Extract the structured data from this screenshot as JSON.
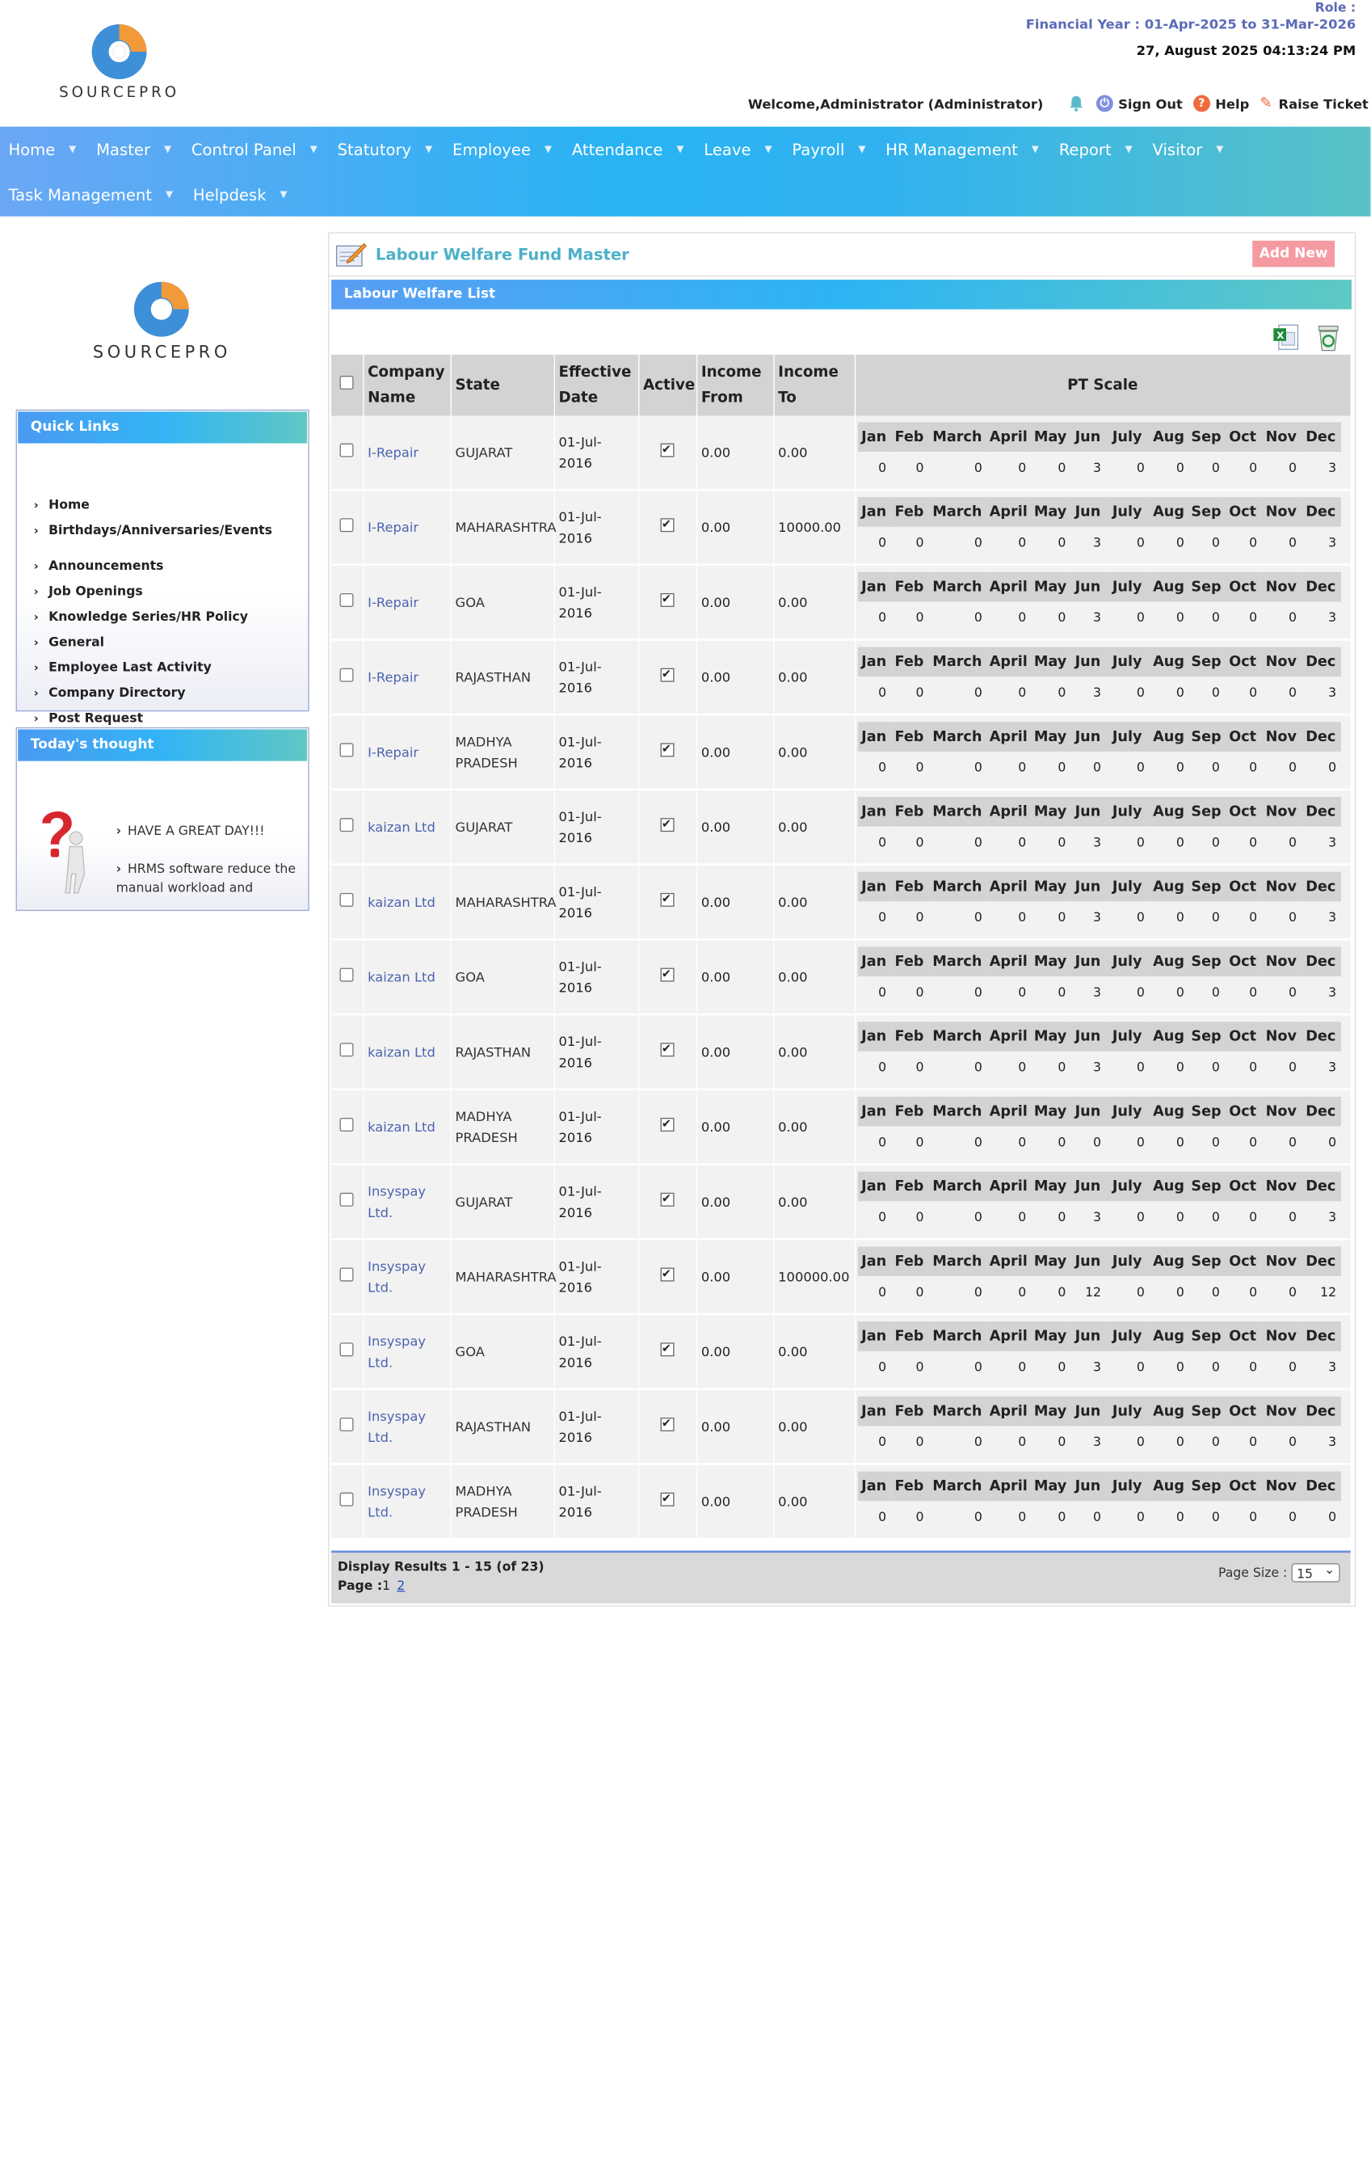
{
  "header": {
    "brand": "SOURCEPRO",
    "role": "Role :",
    "financial_year": "Financial Year : 01-Apr-2025 to 31-Mar-2026",
    "datetime": "27, August 2025 04:13:24 PM",
    "welcome": "Welcome,Administrator (Administrator)",
    "sign_out": "Sign Out",
    "help": "Help",
    "raise_ticket": "Raise Ticket"
  },
  "menu": {
    "row1": [
      "Home",
      "Master",
      "Control Panel",
      "Statutory",
      "Employee",
      "Attendance",
      "Leave",
      "Payroll",
      "HR Management",
      "Report",
      "Visitor"
    ],
    "row2": [
      "Task Management",
      "Helpdesk"
    ]
  },
  "sidebar": {
    "brand": "SOURCEPRO",
    "quick_links_title": "Quick Links",
    "quick_links": [
      "Home",
      "Birthdays/Anniversaries/Events",
      "Announcements",
      "Job Openings",
      "Knowledge Series/HR Policy",
      "General",
      "Employee Last Activity",
      "Company Directory",
      "Post Request"
    ],
    "thought_title": "Today's thought",
    "thoughts": [
      "HAVE A GREAT DAY!!!",
      "HRMS software reduce the",
      "manual workload and"
    ]
  },
  "main": {
    "title": "Labour Welfare Fund Master",
    "add_new": "Add New",
    "list_title": "Labour Welfare List",
    "columns": {
      "company": "Company Name",
      "state": "State",
      "effective_date": "Effective Date",
      "active": "Active",
      "income_from": "Income From",
      "income_to": "Income To",
      "pt_scale": "PT Scale"
    },
    "months": [
      "Jan",
      "Feb",
      "March",
      "April",
      "May",
      "Jun",
      "July",
      "Aug",
      "Sep",
      "Oct",
      "Nov",
      "Dec"
    ],
    "rows": [
      {
        "company": "I-Repair",
        "state": "GUJARAT",
        "date": "01-Jul-2016",
        "from": "0.00",
        "to": "0.00",
        "pt": [
          "0",
          "0",
          "0",
          "0",
          "0",
          "3",
          "0",
          "0",
          "0",
          "0",
          "0",
          "3"
        ]
      },
      {
        "company": "I-Repair",
        "state": "MAHARASHTRA",
        "date": "01-Jul-2016",
        "from": "0.00",
        "to": "10000.00",
        "pt": [
          "0",
          "0",
          "0",
          "0",
          "0",
          "3",
          "0",
          "0",
          "0",
          "0",
          "0",
          "3"
        ]
      },
      {
        "company": "I-Repair",
        "state": "GOA",
        "date": "01-Jul-2016",
        "from": "0.00",
        "to": "0.00",
        "pt": [
          "0",
          "0",
          "0",
          "0",
          "0",
          "3",
          "0",
          "0",
          "0",
          "0",
          "0",
          "3"
        ]
      },
      {
        "company": "I-Repair",
        "state": "RAJASTHAN",
        "date": "01-Jul-2016",
        "from": "0.00",
        "to": "0.00",
        "pt": [
          "0",
          "0",
          "0",
          "0",
          "0",
          "3",
          "0",
          "0",
          "0",
          "0",
          "0",
          "3"
        ]
      },
      {
        "company": "I-Repair",
        "state": "MADHYA PRADESH",
        "date": "01-Jul-2016",
        "from": "0.00",
        "to": "0.00",
        "pt": [
          "0",
          "0",
          "0",
          "0",
          "0",
          "0",
          "0",
          "0",
          "0",
          "0",
          "0",
          "0"
        ]
      },
      {
        "company": "kaizan Ltd",
        "state": "GUJARAT",
        "date": "01-Jul-2016",
        "from": "0.00",
        "to": "0.00",
        "pt": [
          "0",
          "0",
          "0",
          "0",
          "0",
          "3",
          "0",
          "0",
          "0",
          "0",
          "0",
          "3"
        ]
      },
      {
        "company": "kaizan Ltd",
        "state": "MAHARASHTRA",
        "date": "01-Jul-2016",
        "from": "0.00",
        "to": "0.00",
        "pt": [
          "0",
          "0",
          "0",
          "0",
          "0",
          "3",
          "0",
          "0",
          "0",
          "0",
          "0",
          "3"
        ]
      },
      {
        "company": "kaizan Ltd",
        "state": "GOA",
        "date": "01-Jul-2016",
        "from": "0.00",
        "to": "0.00",
        "pt": [
          "0",
          "0",
          "0",
          "0",
          "0",
          "3",
          "0",
          "0",
          "0",
          "0",
          "0",
          "3"
        ]
      },
      {
        "company": "kaizan Ltd",
        "state": "RAJASTHAN",
        "date": "01-Jul-2016",
        "from": "0.00",
        "to": "0.00",
        "pt": [
          "0",
          "0",
          "0",
          "0",
          "0",
          "3",
          "0",
          "0",
          "0",
          "0",
          "0",
          "3"
        ]
      },
      {
        "company": "kaizan Ltd",
        "state": "MADHYA PRADESH",
        "date": "01-Jul-2016",
        "from": "0.00",
        "to": "0.00",
        "pt": [
          "0",
          "0",
          "0",
          "0",
          "0",
          "0",
          "0",
          "0",
          "0",
          "0",
          "0",
          "0"
        ]
      },
      {
        "company": "Insyspay Ltd.",
        "state": "GUJARAT",
        "date": "01-Jul-2016",
        "from": "0.00",
        "to": "0.00",
        "pt": [
          "0",
          "0",
          "0",
          "0",
          "0",
          "3",
          "0",
          "0",
          "0",
          "0",
          "0",
          "3"
        ]
      },
      {
        "company": "Insyspay Ltd.",
        "state": "MAHARASHTRA",
        "date": "01-Jul-2016",
        "from": "0.00",
        "to": "100000.00",
        "pt": [
          "0",
          "0",
          "0",
          "0",
          "0",
          "12",
          "0",
          "0",
          "0",
          "0",
          "0",
          "12"
        ]
      },
      {
        "company": "Insyspay Ltd.",
        "state": "GOA",
        "date": "01-Jul-2016",
        "from": "0.00",
        "to": "0.00",
        "pt": [
          "0",
          "0",
          "0",
          "0",
          "0",
          "3",
          "0",
          "0",
          "0",
          "0",
          "0",
          "3"
        ]
      },
      {
        "company": "Insyspay Ltd.",
        "state": "RAJASTHAN",
        "date": "01-Jul-2016",
        "from": "0.00",
        "to": "0.00",
        "pt": [
          "0",
          "0",
          "0",
          "0",
          "0",
          "3",
          "0",
          "0",
          "0",
          "0",
          "0",
          "3"
        ]
      },
      {
        "company": "Insyspay Ltd.",
        "state": "MADHYA PRADESH",
        "date": "01-Jul-2016",
        "from": "0.00",
        "to": "0.00",
        "pt": [
          "0",
          "0",
          "0",
          "0",
          "0",
          "0",
          "0",
          "0",
          "0",
          "0",
          "0",
          "0"
        ]
      }
    ],
    "pager": {
      "display": "Display Results 1 - 15 (of 23)",
      "page_label": "Page :",
      "current_page": "1",
      "other_page": "2",
      "page_size_label": "Page Size :",
      "page_size": "15"
    }
  }
}
